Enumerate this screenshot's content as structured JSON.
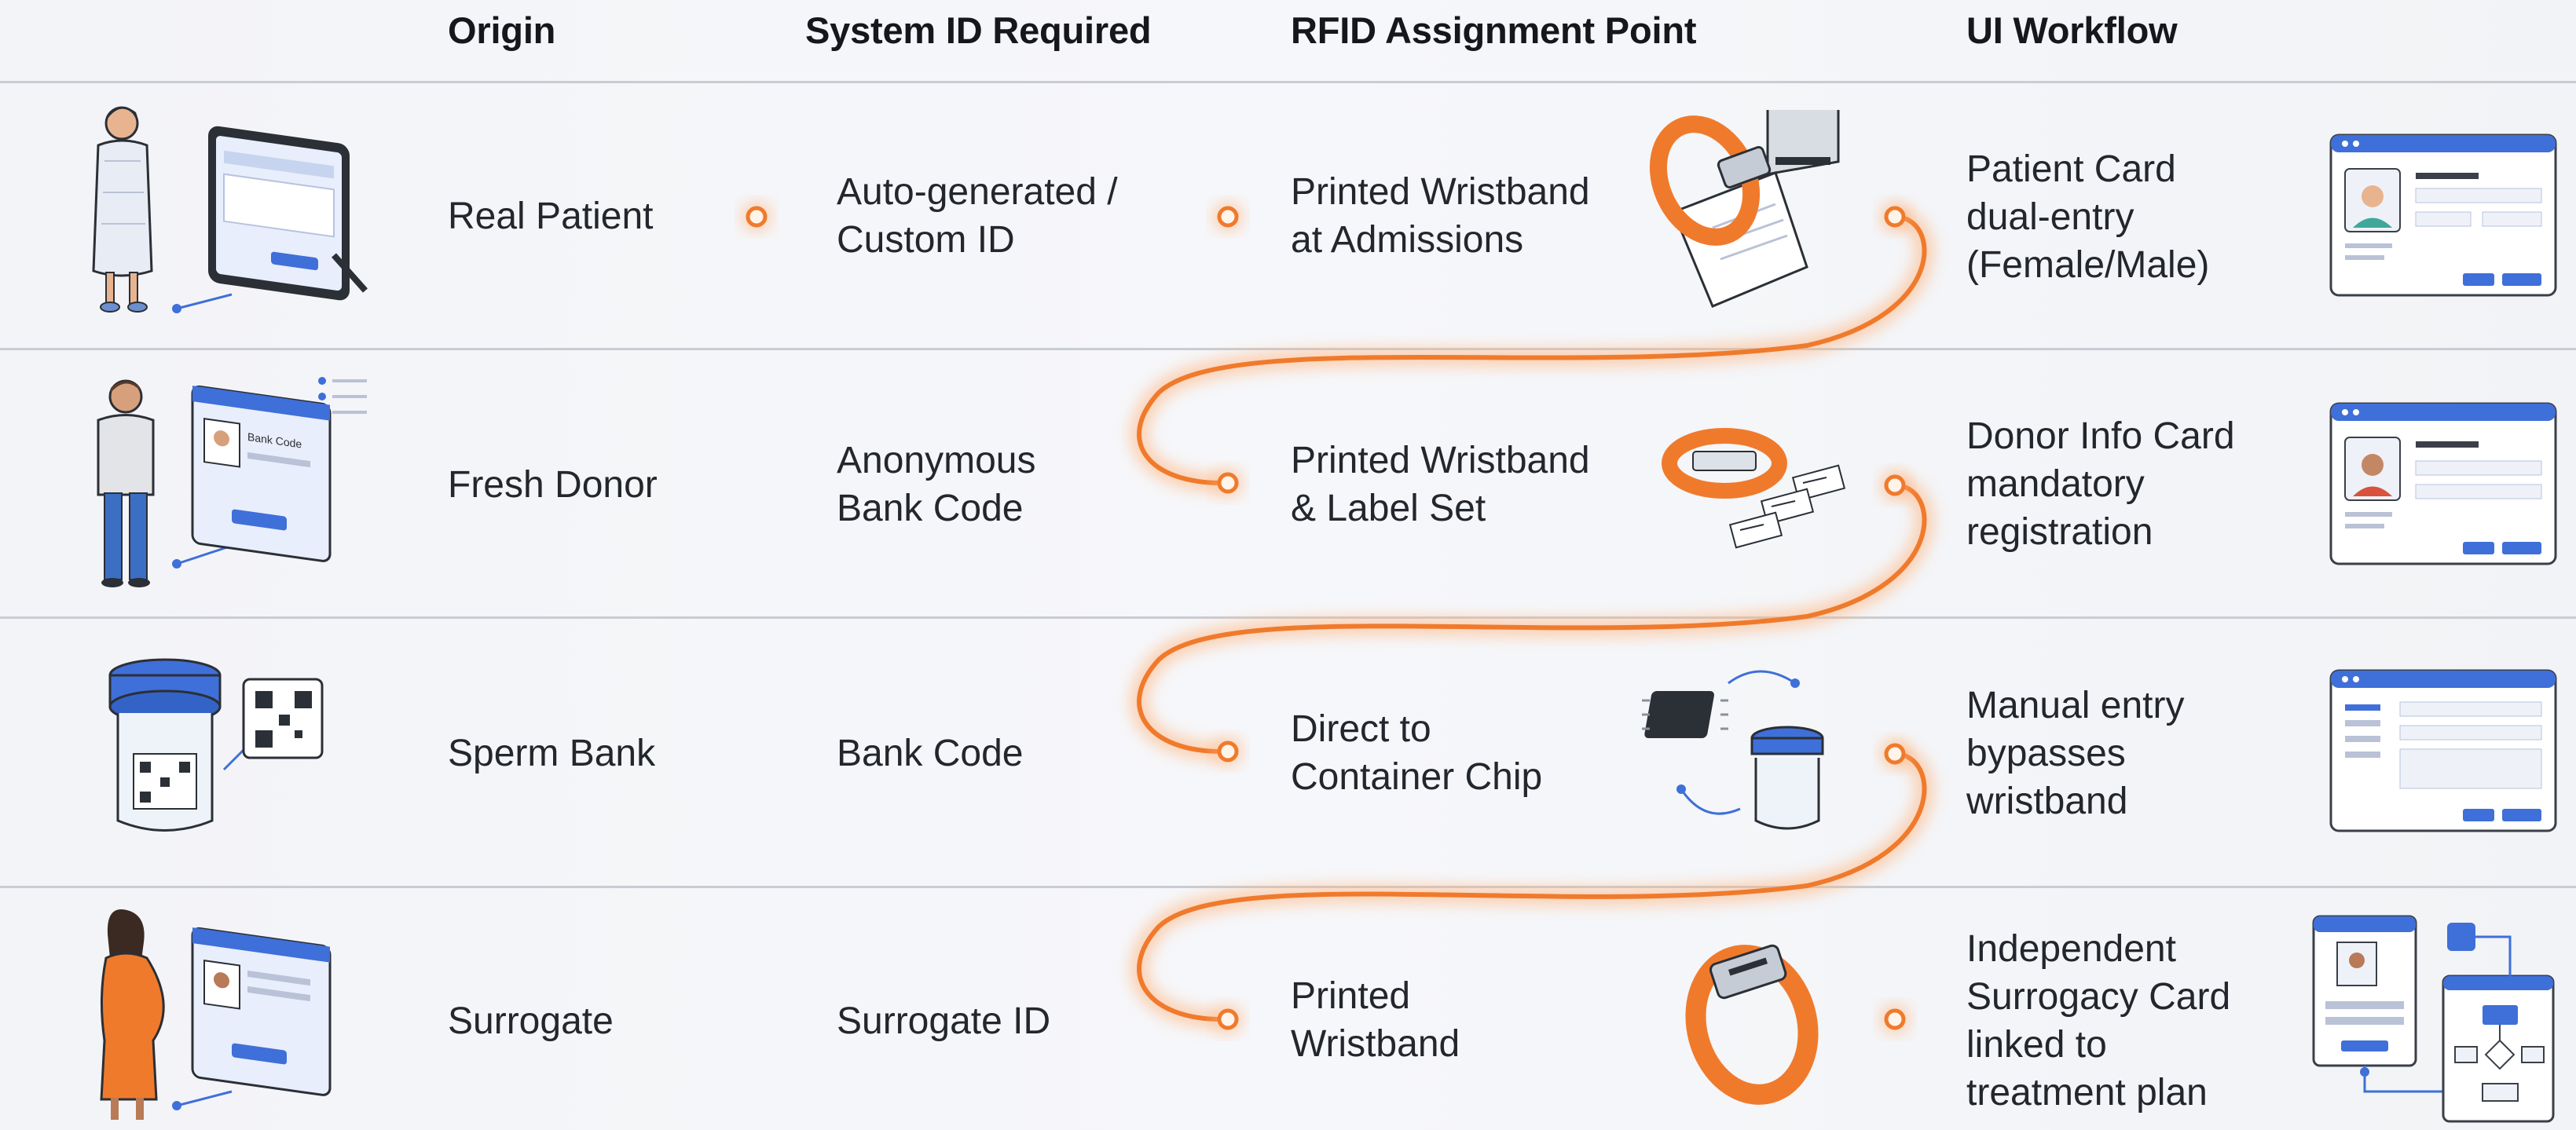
{
  "headers": {
    "origin": "Origin",
    "system_id": "System ID Required",
    "rfid_point": "RFID Assignment Point",
    "ui_workflow": "UI Workflow"
  },
  "rows": [
    {
      "origin": "Real Patient",
      "system_id": [
        "Auto-generated /",
        "Custom ID"
      ],
      "rfid": [
        "Printed Wristband",
        "at Admissions"
      ],
      "workflow": [
        "Patient Card",
        "dual-entry",
        "(Female/Male)"
      ],
      "origin_icon": "patient-gown-tablet-icon",
      "rfid_icon": "wristband-printer-icon",
      "workflow_icon": "patient-card-form-icon"
    },
    {
      "origin": "Fresh Donor",
      "system_id": [
        "Anonymous",
        "Bank Code"
      ],
      "rfid": [
        "Printed Wristband",
        "& Label Set"
      ],
      "workflow": [
        "Donor Info Card",
        "mandatory",
        "registration"
      ],
      "origin_icon": "donor-id-card-icon",
      "rfid_icon": "wristband-labels-icon",
      "workflow_icon": "donor-card-form-icon"
    },
    {
      "origin": "Sperm Bank",
      "system_id": [
        "Bank Code"
      ],
      "rfid": [
        "Direct to",
        "Container Chip"
      ],
      "workflow": [
        "Manual entry",
        "bypasses",
        "wristband"
      ],
      "origin_icon": "sample-container-qr-icon",
      "rfid_icon": "chip-container-icon",
      "workflow_icon": "manual-entry-form-icon"
    },
    {
      "origin": "Surrogate",
      "system_id": [
        "Surrogate ID"
      ],
      "rfid": [
        "Printed",
        "Wristband"
      ],
      "workflow": [
        "Independent",
        "Surrogacy Card",
        "linked to",
        "treatment plan"
      ],
      "origin_icon": "pregnant-surrogate-icon",
      "rfid_icon": "wristband-icon",
      "workflow_icon": "surrogacy-card-flowchart-icon"
    }
  ],
  "id_badge_text": "Bank Code",
  "colors": {
    "accent_orange": "#f07a2c",
    "glow": "#ffb27a",
    "ui_blue": "#3f6fd8",
    "divider": "#c9ccd2"
  }
}
